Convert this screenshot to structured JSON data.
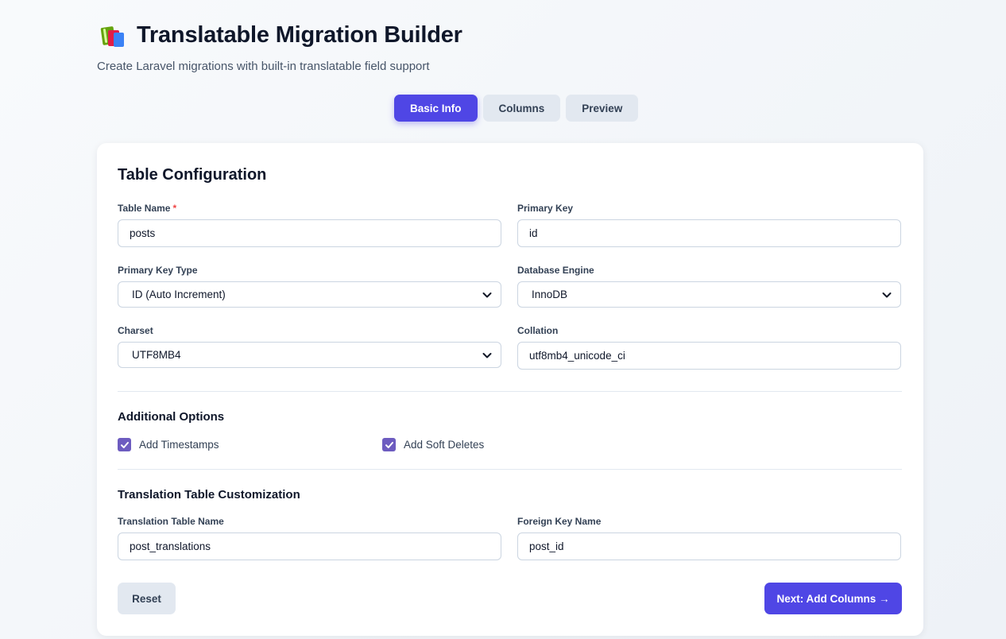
{
  "header": {
    "icon": "books-icon",
    "title": "Translatable Migration Builder",
    "subtitle": "Create Laravel migrations with built-in translatable field support"
  },
  "tabs": [
    {
      "label": "Basic Info",
      "active": true
    },
    {
      "label": "Columns",
      "active": false
    },
    {
      "label": "Preview",
      "active": false
    }
  ],
  "table_config": {
    "title": "Table Configuration",
    "table_name": {
      "label": "Table Name",
      "required_mark": "*",
      "value": "posts"
    },
    "primary_key": {
      "label": "Primary Key",
      "value": "id"
    },
    "primary_key_type": {
      "label": "Primary Key Type",
      "value": "ID (Auto Increment)"
    },
    "database_engine": {
      "label": "Database Engine",
      "value": "InnoDB"
    },
    "charset": {
      "label": "Charset",
      "value": "UTF8MB4"
    },
    "collation": {
      "label": "Collation",
      "value": "utf8mb4_unicode_ci"
    }
  },
  "additional_options": {
    "title": "Additional Options",
    "timestamps": {
      "label": "Add Timestamps",
      "checked": true
    },
    "soft_deletes": {
      "label": "Add Soft Deletes",
      "checked": true
    }
  },
  "translation": {
    "title": "Translation Table Customization",
    "table_name": {
      "label": "Translation Table Name",
      "value": "post_translations"
    },
    "foreign_key": {
      "label": "Foreign Key Name",
      "value": "post_id"
    }
  },
  "actions": {
    "reset": "Reset",
    "next": "Next: Add Columns →"
  },
  "colors": {
    "accent": "#4f46e5",
    "checkbox": "#6d5cc0",
    "background": "#f8fafc"
  }
}
